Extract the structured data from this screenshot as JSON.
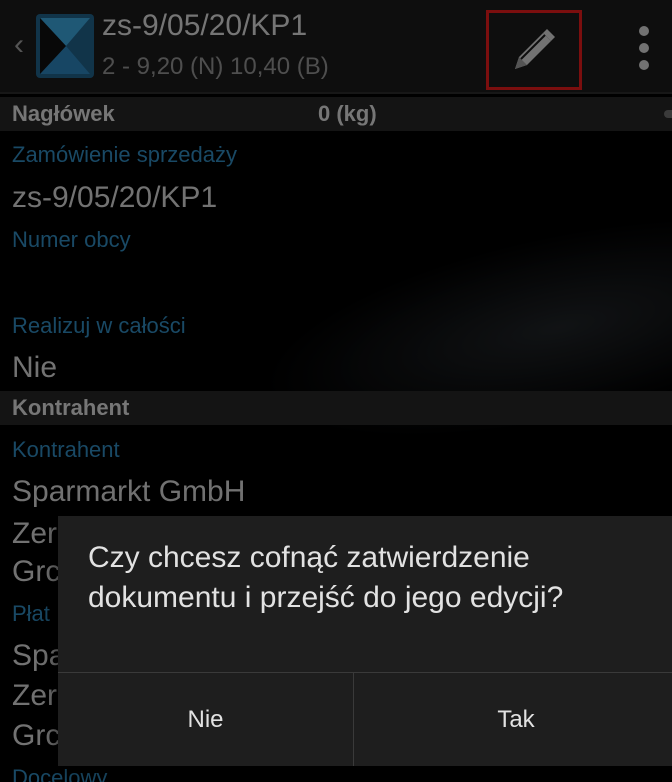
{
  "appbar": {
    "title": "zs-9/05/20/KP1",
    "subtitle": "2 - 9,20 (N) 10,40 (B)",
    "back_icon": "chevron-left-icon",
    "logo_icon": "app-logo-icon",
    "edit_icon": "pencil-icon",
    "menu_icon": "more-vertical-icon",
    "highlight_color": "#e01b1b"
  },
  "sections": {
    "header": {
      "label": "Nagłówek",
      "weight": "0 (kg)"
    },
    "contractor": {
      "label": "Kontrahent"
    }
  },
  "fields": {
    "order": {
      "label": "Zamówienie sprzedaży",
      "value": "zs-9/05/20/KP1"
    },
    "external_number": {
      "label": "Numer obcy",
      "value": ""
    },
    "realize_whole": {
      "label": "Realizuj w całości",
      "value": "Nie"
    },
    "contractor": {
      "label": "Kontrahent",
      "value": "Sparmarkt GmbH"
    },
    "contractor_line2": "Zer",
    "contractor_line3": "Grc",
    "payer": {
      "label": "Płat",
      "value": "Spa"
    },
    "payer_line2": "Zer",
    "payer_line3": "Grc",
    "destination": {
      "label": "Docelowy"
    }
  },
  "dialog": {
    "message": "Czy chcesz cofnąć zatwierdzenie dokumentu i przejść do jego edycji?",
    "no_label": "Nie",
    "yes_label": "Tak"
  },
  "colors": {
    "label_blue": "#2f86b8",
    "value_gray": "#d0d0d0",
    "section_bg": "#262626"
  }
}
